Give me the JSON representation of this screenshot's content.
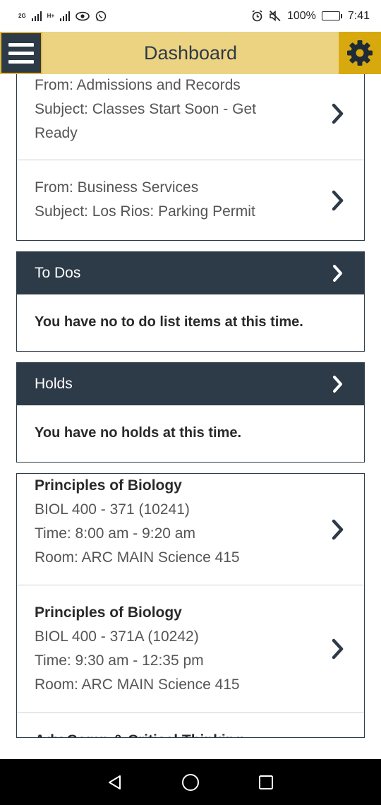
{
  "status_bar": {
    "network_label_top": "2G",
    "network_label_h": "H+",
    "battery": "100%",
    "time": "7:41"
  },
  "header": {
    "title": "Dashboard",
    "menu_icon": "hamburger-menu-icon",
    "settings_icon": "gear-icon"
  },
  "messages": [
    {
      "from": "From: Admissions and Records",
      "subject_line1": "Subject: Classes Start Soon - Get",
      "subject_line2": "Ready"
    },
    {
      "from": "From: Business Services",
      "subject": "Subject: Los Rios: Parking Permit"
    }
  ],
  "todos": {
    "title": "To Dos",
    "empty_text": "You have no to do list items at this time."
  },
  "holds": {
    "title": "Holds",
    "empty_text": "You have no holds at this time."
  },
  "classes": [
    {
      "name": "Principles of Biology",
      "code": "BIOL 400 - 371 (10241)",
      "time": "Time: 8:00 am - 9:20 am",
      "room": "Room: ARC MAIN Science 415"
    },
    {
      "name": "Principles of Biology",
      "code": "BIOL 400 - 371A (10242)",
      "time": "Time: 9:30 am - 12:35 pm",
      "room": "Room: ARC MAIN Science 415"
    },
    {
      "name": "Adv Comp & Critical Thinking"
    }
  ],
  "colors": {
    "header_bg": "#ecd382",
    "menu_bg": "#2d3a47",
    "gear_bg": "#d8a90f",
    "section_head_bg": "#2d3a47"
  },
  "nav": {
    "back_icon": "back-triangle-icon",
    "home_icon": "home-circle-icon",
    "recents_icon": "recents-square-icon"
  }
}
